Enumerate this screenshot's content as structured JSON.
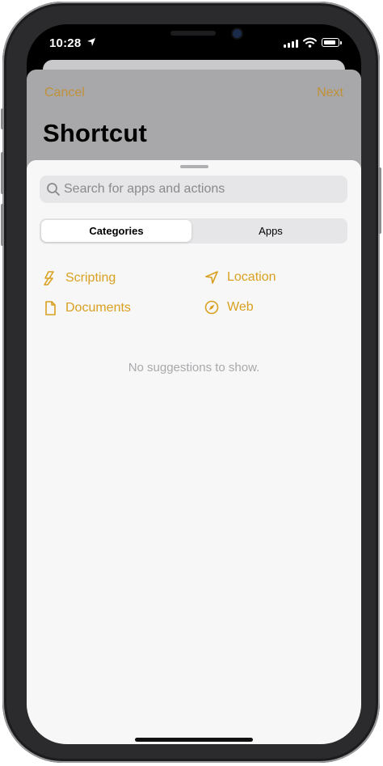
{
  "status_bar": {
    "time": "10:28"
  },
  "nav": {
    "cancel_label": "Cancel",
    "next_label": "Next",
    "title": "Shortcut"
  },
  "search": {
    "placeholder": "Search for apps and actions",
    "value": ""
  },
  "segmented": {
    "selected": "Categories",
    "options": [
      "Categories",
      "Apps"
    ]
  },
  "categories": [
    {
      "label": "Scripting",
      "icon": "scripting-icon"
    },
    {
      "label": "Location",
      "icon": "location-icon"
    },
    {
      "label": "Documents",
      "icon": "document-icon"
    },
    {
      "label": "Web",
      "icon": "compass-icon"
    }
  ],
  "empty_message": "No suggestions to show.",
  "colors": {
    "accent": "#D9A020",
    "sheet": "#F7F7F7",
    "dimmed": "#A8A8AA"
  }
}
